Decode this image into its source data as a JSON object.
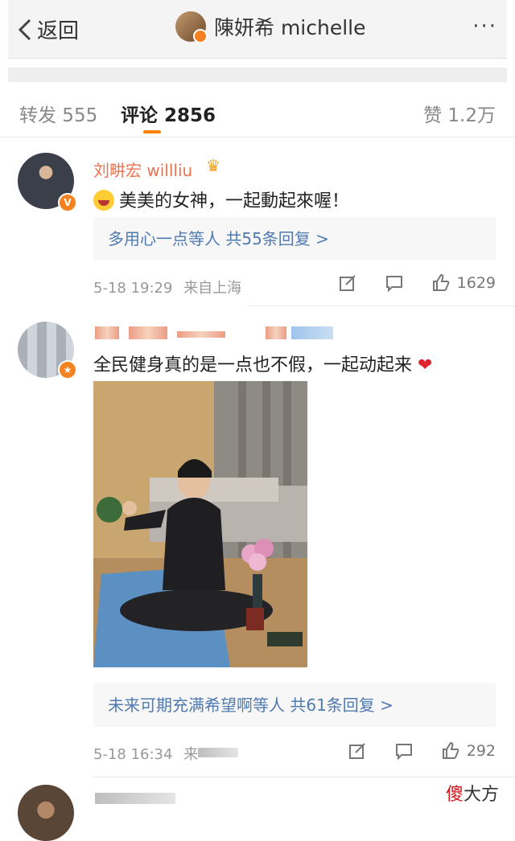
{
  "nav": {
    "back_label": "返回",
    "title": "陳妍希 michelle",
    "more": "···"
  },
  "tabs": {
    "repost": "转发 555",
    "comments": "评论 2856",
    "likes": "赞 1.2万"
  },
  "comments": [
    {
      "username": "刘畊宏 willliu",
      "text": "美美的女神，一起動起來喔！",
      "replies": "多用心一点等人 共55条回复 >",
      "time": "5-18 19:29",
      "source": "来自上海",
      "likes": "1629"
    },
    {
      "username": "",
      "text": "全民健身真的是一点也不假，一起动起来",
      "replies": "未来可期充满希望啊等人 共61条回复 >",
      "time": "5-18 16:34",
      "source": "来",
      "likes": "292"
    }
  ],
  "watermark": {
    "a": "傻",
    "b": "大方"
  },
  "colors": {
    "accent": "#ff8200",
    "username": "#eb7350",
    "link": "#4f7ab0"
  },
  "icons": [
    "chevron-left-icon",
    "more-icon",
    "verified-icon",
    "share-icon",
    "comment-icon",
    "like-icon",
    "heart-icon",
    "laugh-emoji-icon"
  ]
}
